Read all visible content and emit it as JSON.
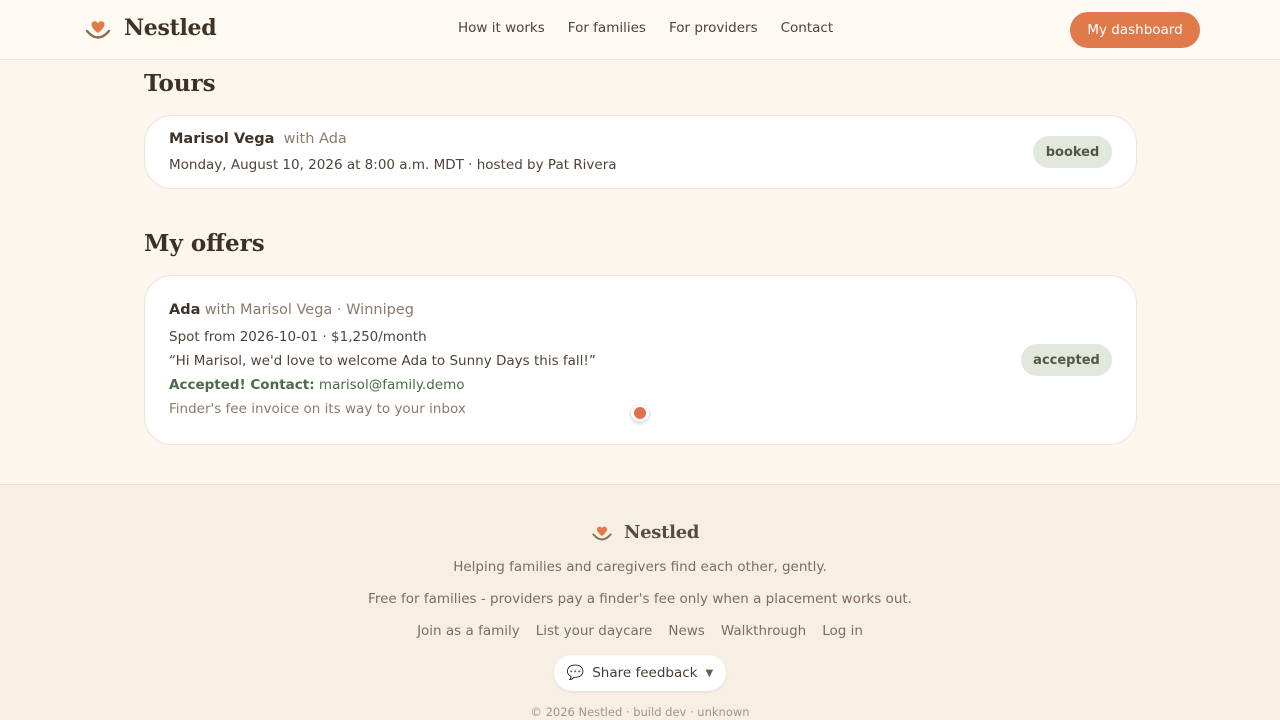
{
  "header": {
    "brand": "Nestled",
    "nav": [
      "How it works",
      "For families",
      "For providers",
      "Contact"
    ],
    "cta": "My dashboard"
  },
  "tours": {
    "title": "Tours",
    "card": {
      "name": "Marisol Vega",
      "with": "with Ada",
      "detail": "Monday, August 10, 2026 at 8:00 a.m. MDT · hosted by Pat Rivera",
      "status": "booked"
    }
  },
  "offers": {
    "title": "My offers",
    "card": {
      "child": "Ada",
      "context": "with Marisol Vega · Winnipeg",
      "spot": "Spot from 2026-10-01 · $1,250/month",
      "message": "“Hi Marisol, we'd love to welcome Ada to Sunny Days this fall!”",
      "accepted_label": "Accepted! Contact:",
      "contact_email": "marisol@family.demo",
      "note": "Finder's fee invoice on its way to your inbox",
      "status": "accepted"
    }
  },
  "footer": {
    "brand": "Nestled",
    "tagline": "Helping families and caregivers find each other, gently.",
    "pricing": "Free for families - providers pay a finder's fee only when a placement works out.",
    "links": [
      "Join as a family",
      "List your daycare",
      "News",
      "Walkthrough",
      "Log in"
    ],
    "feedback": "Share feedback",
    "copyright": "© 2026 Nestled · build dev · unknown"
  },
  "icons": {
    "brand": "heart-smile-icon",
    "feedback": "speech-bubble-icon",
    "chevron": "chevron-down-icon"
  },
  "colors": {
    "accent": "#e07a4a",
    "badge_bg": "#e3e8de",
    "background": "#fcf6ee"
  }
}
